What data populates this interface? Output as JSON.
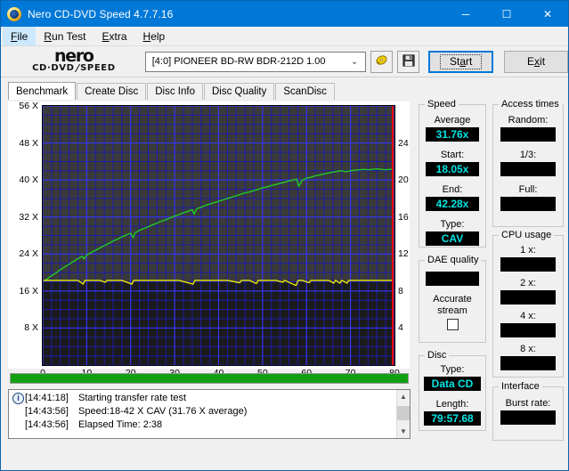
{
  "window": {
    "title": "Nero CD-DVD Speed 4.7.7.16",
    "icon": "nero-disc-icon",
    "controls": {
      "minimize": "─",
      "maximize": "☐",
      "close": "✕"
    }
  },
  "menubar": {
    "items": [
      {
        "label": "File",
        "accel": "F",
        "active": true
      },
      {
        "label": "Run Test",
        "accel": "R",
        "active": false
      },
      {
        "label": "Extra",
        "accel": "E",
        "active": false
      },
      {
        "label": "Help",
        "accel": "H",
        "active": false
      }
    ]
  },
  "toolbar": {
    "logo_main": "nero",
    "logo_sub_left": "CD·DVD",
    "logo_sub_right": "SPEED",
    "drive_value": "[4:0]  PIONEER BD-RW  BDR-212D 1.00",
    "drive_caret": "⌄",
    "eject_icon": "eject-disc-icon",
    "save_icon": "floppy-save-icon",
    "start_label": "Start",
    "exit_label": "Exit"
  },
  "tabs": [
    {
      "label": "Benchmark",
      "active": true
    },
    {
      "label": "Create Disc",
      "active": false
    },
    {
      "label": "Disc Info",
      "active": false
    },
    {
      "label": "Disc Quality",
      "active": false
    },
    {
      "label": "ScanDisc",
      "active": false
    }
  ],
  "chart_data": {
    "type": "line",
    "title": "",
    "xlabel": "",
    "ylabel": "",
    "xlim": [
      0,
      80
    ],
    "ylim": [
      0,
      56
    ],
    "y2lim": [
      0,
      28
    ],
    "grid": true,
    "legend": "none",
    "xticks": [
      0,
      10,
      20,
      30,
      40,
      50,
      60,
      70,
      80
    ],
    "yticks_left": [
      "8 X",
      "16 X",
      "24 X",
      "32 X",
      "40 X",
      "48 X",
      "56 X"
    ],
    "yticks_left_values": [
      8,
      16,
      24,
      32,
      40,
      48,
      56
    ],
    "yticks_right": [
      4,
      8,
      12,
      16,
      20,
      24
    ],
    "marker_line_x": 79.6,
    "marker_line_color": "#ff0000",
    "series": [
      {
        "name": "Transfer rate",
        "color": "#22cc22",
        "axis": "left",
        "x": [
          0.3,
          1,
          2,
          3,
          4,
          5,
          6,
          7,
          8,
          9,
          9.4,
          10,
          11,
          12,
          13,
          14,
          15,
          16,
          17,
          18,
          19,
          20,
          20.6,
          21,
          22,
          23,
          24,
          25,
          26,
          27,
          28,
          29,
          30,
          31,
          32,
          33,
          34,
          34.4,
          35,
          36,
          37,
          38,
          39,
          40,
          41,
          42,
          43,
          44,
          45,
          46,
          47,
          48,
          49,
          50,
          51,
          52,
          53,
          54,
          55,
          56,
          57,
          57.8,
          58.2,
          59,
          60,
          61,
          62,
          63,
          64,
          65,
          66,
          67,
          68,
          69,
          70,
          71,
          72,
          73,
          74,
          75,
          76,
          77,
          78,
          79,
          79.5
        ],
        "y": [
          18.2,
          18.6,
          19.3,
          19.9,
          20.6,
          21.2,
          21.8,
          22.4,
          23.0,
          23.5,
          22.9,
          23.8,
          24.3,
          24.8,
          25.3,
          25.8,
          26.3,
          26.8,
          27.2,
          27.7,
          28.1,
          28.5,
          27.5,
          28.6,
          29.1,
          29.5,
          29.9,
          30.3,
          30.7,
          31.1,
          31.4,
          31.8,
          32.2,
          32.5,
          32.9,
          33.2,
          33.6,
          32.6,
          33.8,
          34.1,
          34.5,
          34.8,
          35.1,
          35.4,
          35.7,
          36.0,
          36.3,
          36.6,
          36.9,
          37.2,
          37.4,
          37.7,
          38.0,
          38.3,
          38.5,
          38.8,
          39.0,
          39.3,
          39.5,
          39.8,
          40.0,
          40.2,
          38.6,
          39.9,
          40.4,
          40.6,
          40.9,
          41.1,
          41.3,
          41.5,
          41.7,
          41.9,
          42.0,
          41.8,
          42.0,
          42.1,
          42.2,
          42.3,
          42.2,
          42.3,
          42.4,
          42.3,
          42.2,
          42.3,
          42.3
        ]
      },
      {
        "name": "Access / CPU trace",
        "color": "#e8e800",
        "axis": "left",
        "x": [
          0.3,
          2,
          4,
          6,
          8,
          9.2,
          9.6,
          11,
          13,
          14.2,
          14.6,
          16,
          18,
          20.3,
          20.7,
          22,
          25,
          28,
          31,
          34.2,
          34.6,
          36,
          39,
          42,
          44.8,
          45.2,
          47,
          48.6,
          49,
          51,
          53,
          54.6,
          55,
          57.6,
          58.1,
          59,
          60.6,
          61,
          63,
          65,
          66.2,
          66.6,
          67.6,
          68,
          69.2,
          69.6,
          71,
          73,
          75,
          77,
          79,
          79.5
        ],
        "y": [
          18.3,
          18.3,
          18.3,
          18.3,
          18.3,
          17.5,
          18.3,
          18.3,
          18.3,
          17.9,
          18.3,
          18.3,
          18.3,
          17.5,
          18.3,
          18.3,
          18.3,
          18.3,
          18.3,
          17.5,
          18.3,
          18.3,
          18.3,
          18.3,
          17.8,
          18.3,
          18.3,
          17.6,
          18.3,
          18.3,
          18.3,
          17.9,
          18.3,
          17.2,
          18.3,
          18.3,
          17.8,
          18.3,
          18.3,
          18.3,
          17.7,
          18.3,
          17.7,
          18.3,
          17.7,
          18.3,
          18.3,
          18.3,
          18.3,
          18.3,
          18.3,
          18.3
        ]
      }
    ]
  },
  "progress": {
    "percent": 100,
    "color": "#12a012"
  },
  "log": {
    "lines": [
      {
        "icon": "info-icon",
        "time": "[14:41:18]",
        "message": "Starting transfer rate test"
      },
      {
        "icon": "",
        "time": "[14:43:56]",
        "message": "Speed:18-42 X CAV (31.76 X average)"
      },
      {
        "icon": "",
        "time": "[14:43:56]",
        "message": "Elapsed Time:  2:38"
      }
    ],
    "scroll_up": "▲",
    "scroll_down": "▼"
  },
  "panels": {
    "speed": {
      "title": "Speed",
      "fields": [
        {
          "label": "Average",
          "value": "31.76x"
        },
        {
          "label": "Start:",
          "value": "18.05x"
        },
        {
          "label": "End:",
          "value": "42.28x"
        },
        {
          "label": "Type:",
          "value": "CAV"
        }
      ]
    },
    "dae_quality": {
      "title": "DAE quality",
      "value": "",
      "accurate_label_1": "Accurate",
      "accurate_label_2": "stream",
      "accurate_checked": false
    },
    "disc": {
      "title": "Disc",
      "fields": [
        {
          "label": "Type:",
          "value": "Data CD"
        },
        {
          "label": "Length:",
          "value": "79:57.68"
        }
      ]
    },
    "access_times": {
      "title": "Access times",
      "fields": [
        {
          "label": "Random:",
          "value": ""
        },
        {
          "label": "1/3:",
          "value": ""
        },
        {
          "label": "Full:",
          "value": ""
        }
      ]
    },
    "cpu_usage": {
      "title": "CPU usage",
      "fields": [
        {
          "label": "1 x:",
          "value": ""
        },
        {
          "label": "2 x:",
          "value": ""
        },
        {
          "label": "4 x:",
          "value": ""
        },
        {
          "label": "8 x:",
          "value": ""
        }
      ]
    },
    "interface": {
      "title": "Interface",
      "fields": [
        {
          "label": "Burst rate:",
          "value": ""
        }
      ]
    }
  },
  "colors": {
    "titlebar": "#0078d7",
    "accent": "#0078d7",
    "value_text": "#00e5e5",
    "value_bg": "#000000",
    "grid": "#2222cc",
    "plot_bg": "#111111",
    "series_green": "#22cc22",
    "series_yellow": "#e8e800",
    "marker_red": "#ff0000",
    "progress": "#12a012"
  }
}
